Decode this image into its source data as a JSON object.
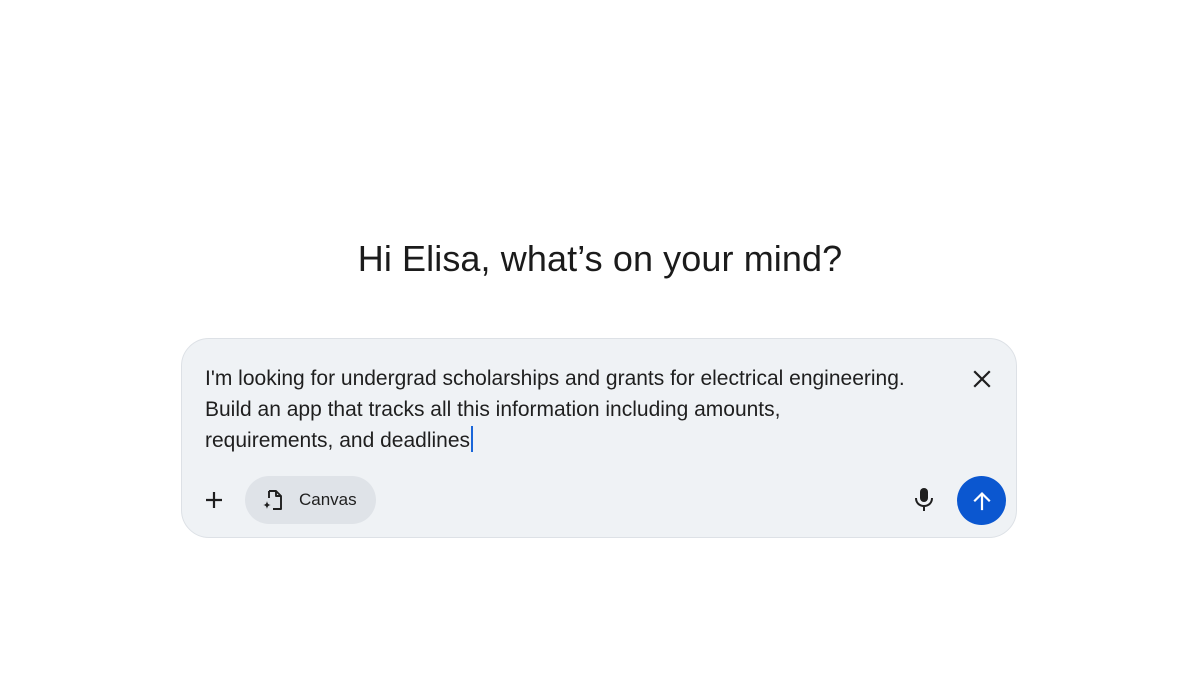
{
  "greeting": "Hi Elisa, what’s on your mind?",
  "composer": {
    "prompt_text": "I'm looking for undergrad scholarships and grants for electrical engineering.\nBuild an app that tracks all this information including amounts,\nrequirements, and deadlines",
    "clear_icon": "close-icon",
    "add_icon": "plus-icon",
    "tool_chip": {
      "label": "Canvas",
      "icon": "canvas-document-sparkle-icon"
    },
    "mic_icon": "microphone-icon",
    "send_icon": "arrow-up-icon"
  },
  "colors": {
    "background": "#ffffff",
    "composer_bg": "#eff2f5",
    "chip_bg": "#dfe3e8",
    "send_button": "#0b57d0",
    "caret": "#1a66d9",
    "text": "#1f1f1f"
  }
}
